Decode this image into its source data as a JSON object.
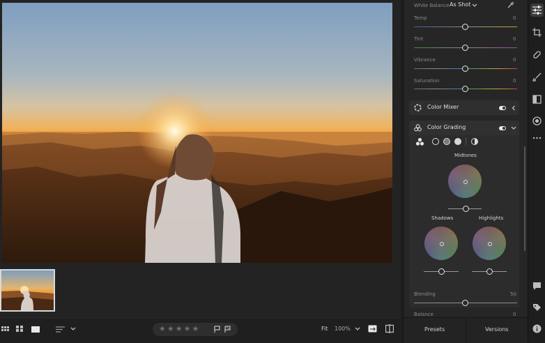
{
  "panel": {
    "white_balance_label": "White Balance",
    "white_balance_value": "As Shot",
    "sliders": [
      {
        "label": "Temp",
        "value": "0"
      },
      {
        "label": "Tint",
        "value": "0"
      },
      {
        "label": "Vibrance",
        "value": "0"
      },
      {
        "label": "Saturation",
        "value": "0"
      }
    ],
    "color_mixer_title": "Color Mixer",
    "color_grading_title": "Color Grading",
    "midtones_label": "Midtones",
    "shadows_label": "Shadows",
    "highlights_label": "Highlights",
    "blending_label": "Blending",
    "blending_value": "50",
    "balance_label": "Balance",
    "balance_value": "0",
    "presets_label": "Presets",
    "versions_label": "Versions"
  },
  "bottombar": {
    "fit_label": "Fit",
    "zoom_value": "100%",
    "stars": "★★★★★"
  },
  "colors": {
    "accent": "#e5e5e5",
    "panel_bg": "#262626",
    "section_bg": "#2f2f2f",
    "sky_top": "#86a6c6",
    "horizon": "#f2a33c"
  }
}
